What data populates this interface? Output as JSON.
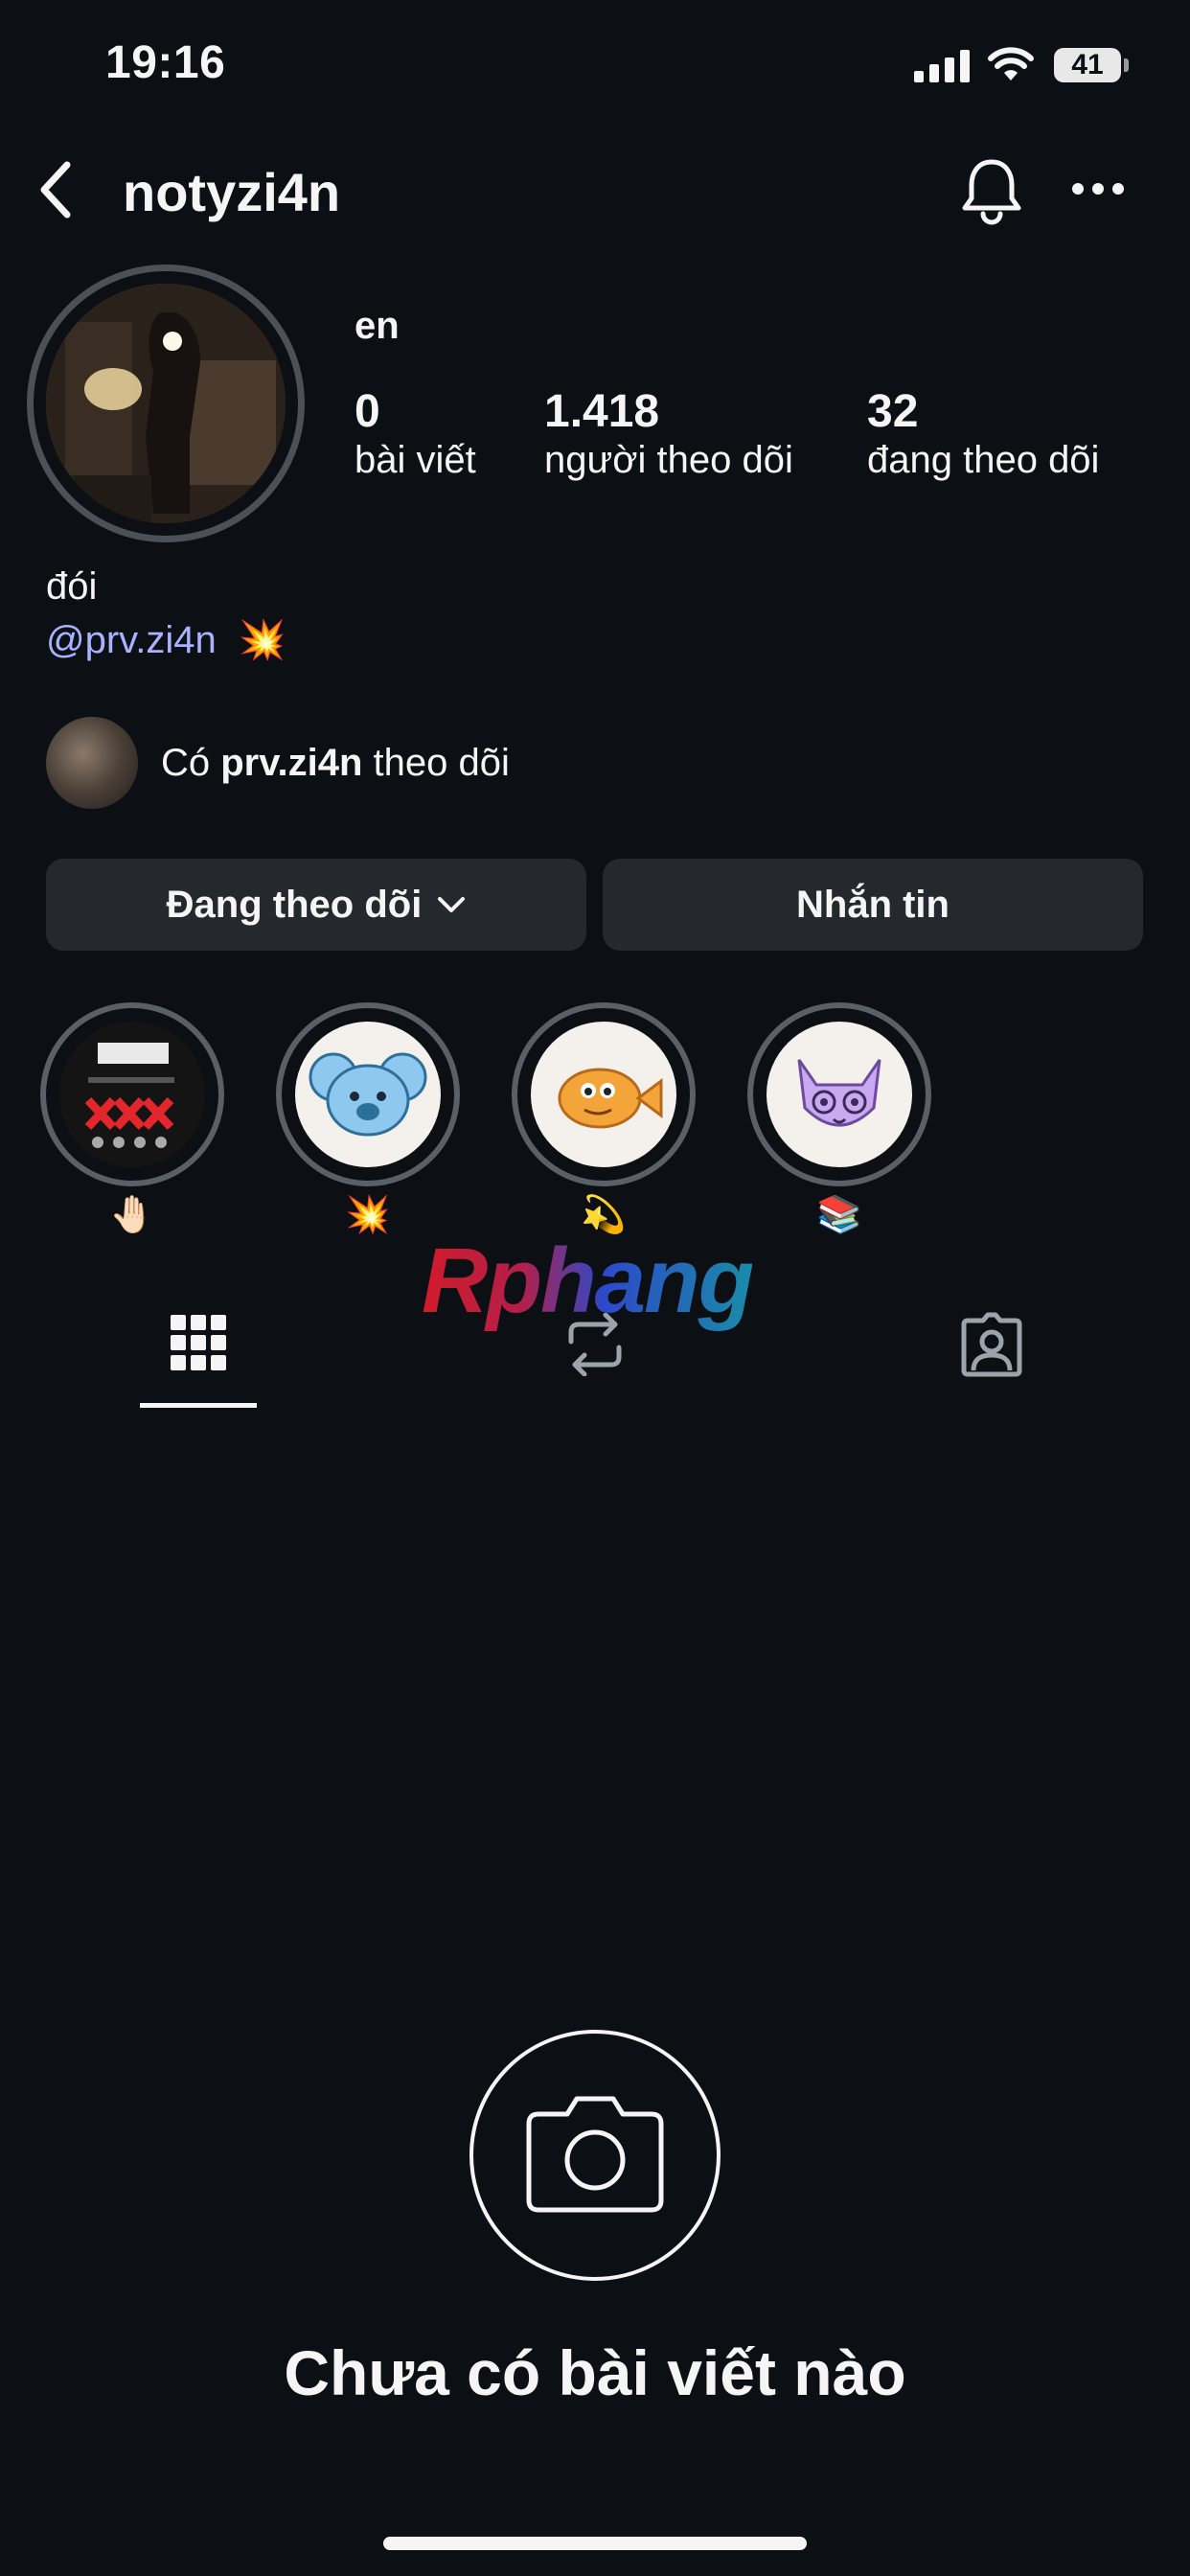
{
  "status_bar": {
    "time": "19:16",
    "battery": "41"
  },
  "header": {
    "username": "notyzi4n"
  },
  "profile": {
    "name": "en",
    "stats": [
      {
        "value": "0",
        "label": "bài viết"
      },
      {
        "value": "1.418",
        "label": "người theo dõi"
      },
      {
        "value": "32",
        "label": "đang theo dõi"
      }
    ],
    "bio": "đói",
    "bio_link": "@prv.zi4n",
    "bio_emoji": "💥"
  },
  "mutual": {
    "prefix": "Có ",
    "username": "prv.zi4n",
    "suffix": " theo dõi"
  },
  "buttons": {
    "following": "Đang theo dõi",
    "message": "Nhắn tin"
  },
  "highlights": [
    {
      "label": "🤚🏻"
    },
    {
      "label": "💥"
    },
    {
      "label": "💫"
    },
    {
      "label": "📚"
    }
  ],
  "watermark": "Rphang",
  "empty_state": {
    "title": "Chưa có bài viết nào"
  },
  "colors": {
    "background": "#0c1014",
    "button": "#25292e",
    "link": "#a8b2ff"
  }
}
